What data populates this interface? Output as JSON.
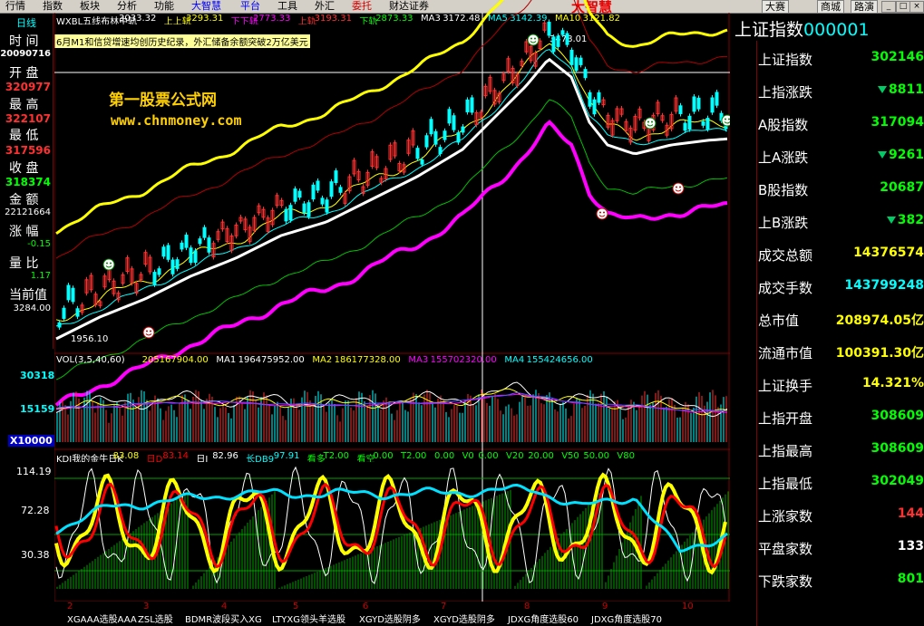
{
  "menu": {
    "items": [
      "行情",
      "指数",
      "板块",
      "分析",
      "功能",
      "大智慧",
      "平台",
      "工具",
      "外汇",
      "委托",
      "财达证券"
    ],
    "logo": "大智慧",
    "right_buttons": [
      "大赛",
      "商城",
      "路演"
    ]
  },
  "left_panel": {
    "period": "日线",
    "labels": [
      "时 间",
      "开 盘",
      "最 高",
      "最 低",
      "收 盘",
      "金 额",
      "涨 幅",
      "量 比",
      "当前值"
    ],
    "values": {
      "time": "20090716",
      "open": "320977",
      "high": "322107",
      "low": "317596",
      "close": "318374",
      "amount": "22121664",
      "change": "-0.15",
      "volume_ratio": "1.17",
      "current": "3284.00"
    }
  },
  "price_header": [
    {
      "text": "WXBL五线布林中轨",
      "color": "#ffffff"
    },
    {
      "text": "3033.32",
      "color": "#ffffff"
    },
    {
      "text": "上上轨",
      "color": "#ffff00"
    },
    {
      "text": "3293.31",
      "color": "#ffff00"
    },
    {
      "text": "下下轨",
      "color": "#ff00ff"
    },
    {
      "text": "2773.33",
      "color": "#ff00ff"
    },
    {
      "text": "上轨",
      "color": "#ff3030"
    },
    {
      "text": "3193.31",
      "color": "#ff3030"
    },
    {
      "text": "下轨",
      "color": "#00ff00"
    },
    {
      "text": "2873.33",
      "color": "#00ff00"
    },
    {
      "text": "MA3",
      "color": "#ffffff"
    },
    {
      "text": "3172.48",
      "color": "#ffffff"
    },
    {
      "text": "MA5",
      "color": "#00ffff"
    },
    {
      "text": "3142.39",
      "color": "#00ffff"
    },
    {
      "text": "MA10",
      "color": "#ffff00"
    },
    {
      "text": "3121.82",
      "color": "#ffff00"
    }
  ],
  "news": "6月M1和信贷增速均创历史纪录，外汇储备余额突破2万亿美元",
  "watermark": {
    "name": "第一股票公式网",
    "url": "www.chnmoney.com"
  },
  "price_chart": {
    "peak_label": "3478.01",
    "low_label": "1956.10"
  },
  "volume": {
    "header": [
      {
        "text": "VOL(3,5,40,60)",
        "color": "#ffffff"
      },
      {
        "text": "205167904.00",
        "color": "#ffff00"
      },
      {
        "text": "MA1",
        "color": "#ffffff"
      },
      {
        "text": "196475952.00",
        "color": "#ffffff"
      },
      {
        "text": "MA2",
        "color": "#ffff00"
      },
      {
        "text": "186177328.00",
        "color": "#ffff00"
      },
      {
        "text": "MA3",
        "color": "#ff00ff"
      },
      {
        "text": "155702320.00",
        "color": "#ff00ff"
      },
      {
        "text": "MA4",
        "color": "#00ffff"
      },
      {
        "text": "155424656.00",
        "color": "#00ffff"
      }
    ],
    "axis": [
      "30318",
      "15159",
      "X10000"
    ]
  },
  "kdj": {
    "header": [
      {
        "text": "KDJ我的金牛日K",
        "color": "#ffffff"
      },
      {
        "text": "83.08",
        "color": "#ffff00"
      },
      {
        "text": "日D",
        "color": "#ff0000"
      },
      {
        "text": "83.14",
        "color": "#ff0000"
      },
      {
        "text": "日J",
        "color": "#ffffff"
      },
      {
        "text": "82.96",
        "color": "#ffffff"
      },
      {
        "text": "长DB9",
        "color": "#00ffff"
      },
      {
        "text": "97.91",
        "color": "#00ffff"
      },
      {
        "text": "看多",
        "color": "#00ff00"
      },
      {
        "text": "T2.00",
        "color": "#00ff00"
      },
      {
        "text": "看空",
        "color": "#00ff00"
      },
      {
        "text": "0.00",
        "color": "#00ff00"
      },
      {
        "text": "T2.00",
        "color": "#00ff00"
      },
      {
        "text": "0.00",
        "color": "#00ff00"
      },
      {
        "text": "V0",
        "color": "#00ff00"
      },
      {
        "text": "0.00",
        "color": "#00ff00"
      },
      {
        "text": "V20",
        "color": "#00ff00"
      },
      {
        "text": "20.00",
        "color": "#00ff00"
      },
      {
        "text": "V50",
        "color": "#00ff00"
      },
      {
        "text": "50.00",
        "color": "#00ff00"
      },
      {
        "text": "V80",
        "color": "#00ff00"
      }
    ],
    "axis": [
      "114.19",
      "72.28",
      "30.38"
    ]
  },
  "date_labels": [
    "2",
    "3",
    "4",
    "5",
    "6",
    "7",
    "8",
    "9",
    "10"
  ],
  "bottom_tabs": [
    "XGAAA选股AAA",
    "ZSL选股",
    "BDMR波段买入XG",
    "LTYXG领头羊选股",
    "XGYD选股阴多",
    "XGYD选股阴多",
    "JDXG角度选股60",
    "JDXG角度选股70"
  ],
  "right_panel": {
    "title": "上证指数",
    "code": "000001",
    "rows": [
      {
        "label": "上证指数",
        "value": "302146",
        "color": "#00ff00",
        "arrow": false
      },
      {
        "label": "上指涨跌",
        "value": "8811",
        "color": "#00ff00",
        "arrow": true
      },
      {
        "label": "A股指数",
        "value": "317094",
        "color": "#00ff00",
        "arrow": false
      },
      {
        "label": "上A涨跌",
        "value": "9261",
        "color": "#00ff00",
        "arrow": true
      },
      {
        "label": "B股指数",
        "value": "20687",
        "color": "#00ff00",
        "arrow": false
      },
      {
        "label": "上B涨跌",
        "value": "382",
        "color": "#00ff00",
        "arrow": true
      },
      {
        "label": "成交总额",
        "value": "14376574",
        "color": "#ffff00",
        "arrow": false
      },
      {
        "label": "成交手数",
        "value": "143799248",
        "color": "#00ffff",
        "arrow": false
      },
      {
        "label": "总市值",
        "value": "208974.05亿",
        "color": "#ffff00",
        "arrow": false
      },
      {
        "label": "流通市值",
        "value": "100391.30亿",
        "color": "#ffff00",
        "arrow": false
      },
      {
        "label": "上证换手",
        "value": "14.321%",
        "color": "#ffff00",
        "arrow": false
      },
      {
        "label": "上指开盘",
        "value": "308609",
        "color": "#00ff00",
        "arrow": false
      },
      {
        "label": "上指最高",
        "value": "308609",
        "color": "#00ff00",
        "arrow": false
      },
      {
        "label": "上指最低",
        "value": "302049",
        "color": "#00ff00",
        "arrow": false
      },
      {
        "label": "上涨家数",
        "value": "144",
        "color": "#ff3030",
        "arrow": false
      },
      {
        "label": "平盘家数",
        "value": "133",
        "color": "#ffffff",
        "arrow": false
      },
      {
        "label": "下跌家数",
        "value": "801",
        "color": "#00ff00",
        "arrow": false
      }
    ]
  },
  "colors": {
    "upper_upper": "#ffff00",
    "lower_lower": "#ff00ff",
    "upper": "#b00000",
    "lower": "#00c000",
    "middle": "#ffffff",
    "ma_cyan": "#00ffff",
    "up_candle": "#ff3030",
    "down_candle": "#00ffff"
  }
}
